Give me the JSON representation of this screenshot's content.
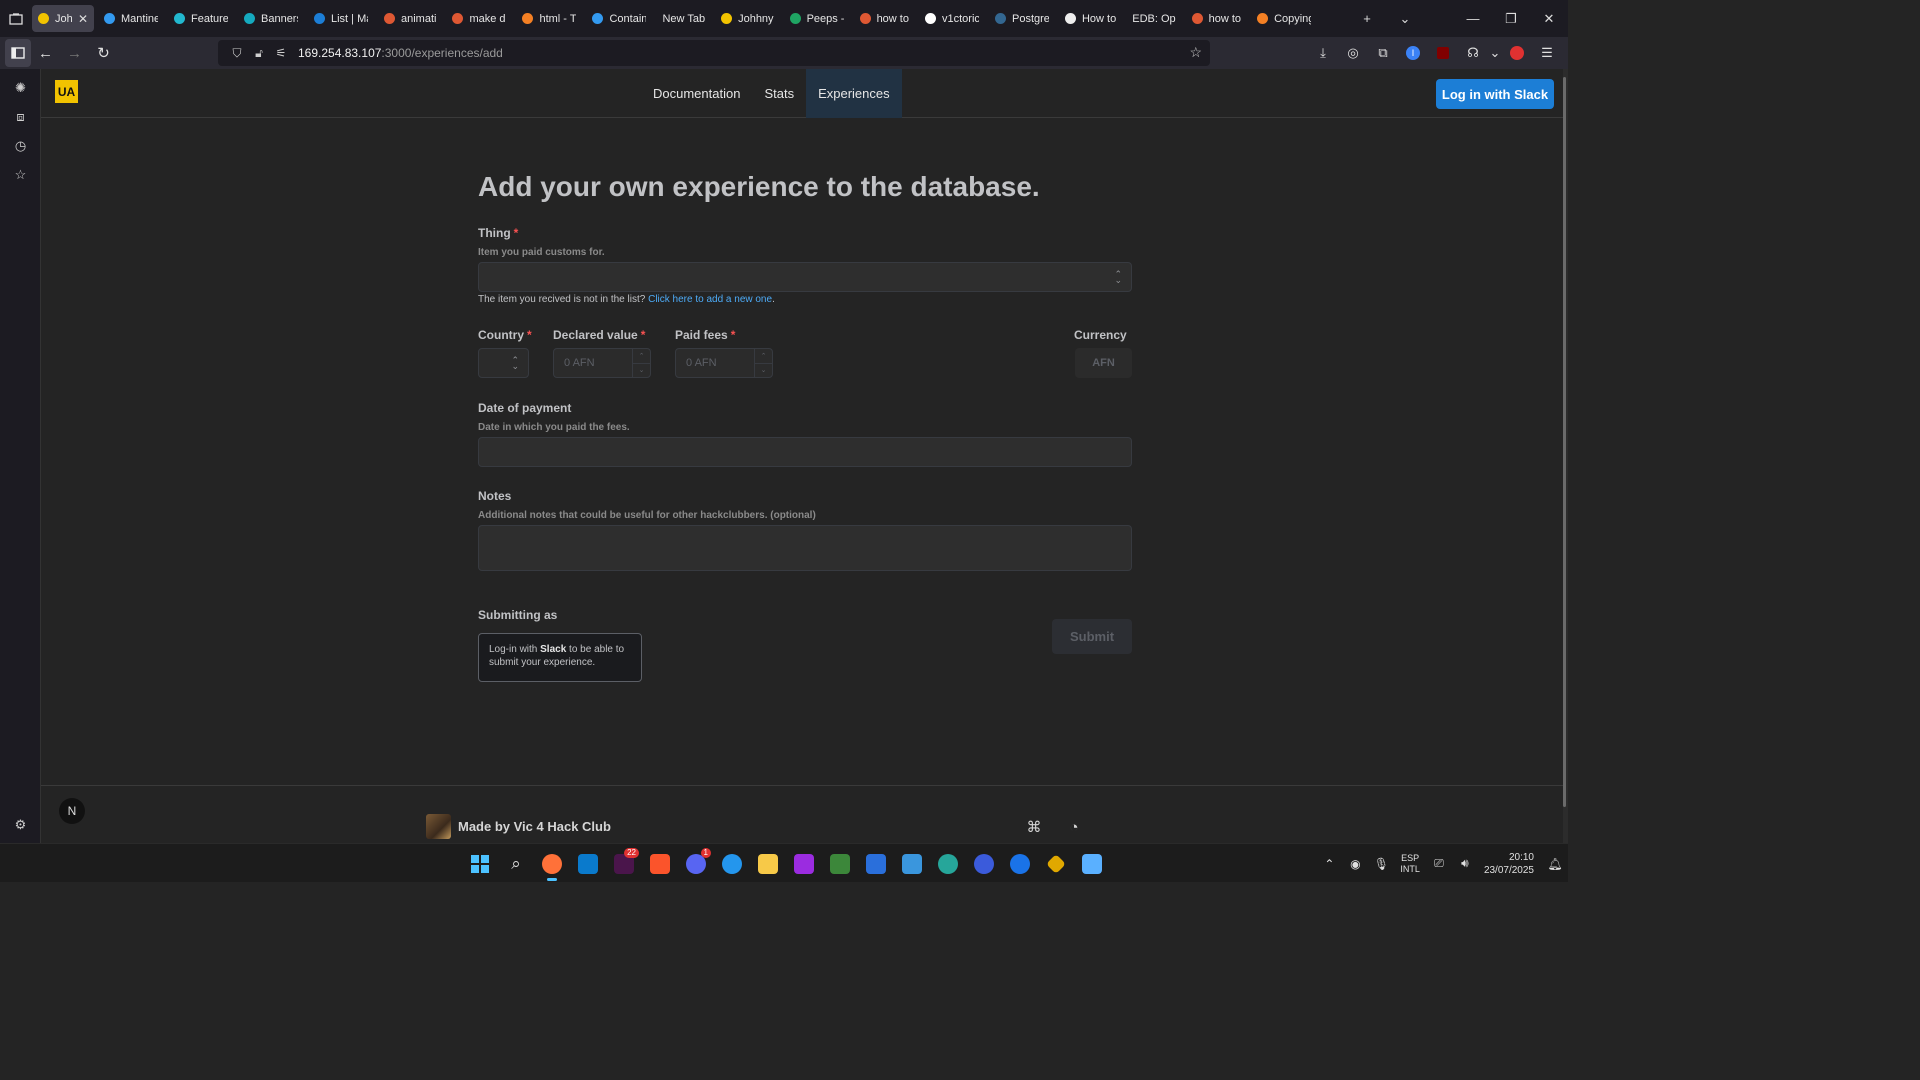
{
  "browser": {
    "tabs": [
      {
        "label": "Johh",
        "icon": "johnny-favicon",
        "color": "#f2c300",
        "active": true
      },
      {
        "label": "Mantine",
        "icon": "mantine-favicon",
        "color": "#339af0"
      },
      {
        "label": "Feature",
        "icon": "mantine-favicon",
        "color": "#22b8cf"
      },
      {
        "label": "Banners",
        "icon": "mantine-favicon",
        "color": "#15aabf"
      },
      {
        "label": "List | Ma",
        "icon": "mantine-favicon",
        "color": "#1c7ed6"
      },
      {
        "label": "animati",
        "icon": "ddg-favicon",
        "color": "#de5833"
      },
      {
        "label": "make di",
        "icon": "ddg-favicon",
        "color": "#de5833"
      },
      {
        "label": "html - T",
        "icon": "stackoverflow-favicon",
        "color": "#f48024"
      },
      {
        "label": "Contain",
        "icon": "mantine-favicon",
        "color": "#339af0"
      },
      {
        "label": "New Tab",
        "icon": "",
        "color": ""
      },
      {
        "label": "Johhny",
        "icon": "johnny-favicon",
        "color": "#f2c300"
      },
      {
        "label": "Peeps -",
        "icon": "sheets-favicon",
        "color": "#1fa463"
      },
      {
        "label": "how to",
        "icon": "ddg-favicon",
        "color": "#de5833"
      },
      {
        "label": "v1ctoric",
        "icon": "github-favicon",
        "color": "#ffffff"
      },
      {
        "label": "Postgre",
        "icon": "postgres-favicon",
        "color": "#336791"
      },
      {
        "label": "How to",
        "icon": "hotjar-favicon",
        "color": "#eeeeee"
      },
      {
        "label": "EDB: Op",
        "icon": "",
        "color": ""
      },
      {
        "label": "how to",
        "icon": "ddg-favicon",
        "color": "#de5833"
      },
      {
        "label": "Copying",
        "icon": "stackoverflow-favicon",
        "color": "#f48024"
      }
    ],
    "url_host": "169.254.83.107",
    "url_rest": ":3000/experiences/add"
  },
  "site": {
    "logo_text": "UA",
    "nav": [
      "Documentation",
      "Stats",
      "Experiences"
    ],
    "login_label": "Log in with Slack"
  },
  "form": {
    "title": "Add your own experience to the database.",
    "thing_label": "Thing",
    "thing_desc": "Item you paid customs for.",
    "help_text": "The item you recived is not in the list?",
    "help_link": "Click here to add a new one",
    "help_dot": ".",
    "country_label": "Country",
    "declared_label": "Declared value",
    "declared_placeholder": "0 AFN",
    "fees_label": "Paid fees",
    "fees_placeholder": "0 AFN",
    "currency_label": "Currency",
    "currency_value": "AFN",
    "date_label": "Date of payment",
    "date_desc": "Date in which you paid the fees.",
    "notes_label": "Notes",
    "notes_desc": "Additional notes that could be useful for other hackclubbers. (optional)",
    "submitting_label": "Submitting as",
    "notice_pre": "Log-in with ",
    "notice_bold": "Slack",
    "notice_post": " to be able to submit your experience.",
    "submit_label": "Submit",
    "required_mark": "*"
  },
  "footer": {
    "made_by": "Made by Vic 4 Hack Club"
  },
  "taskbar": {
    "discord_badge": "1",
    "slack_badge": "22",
    "lang_line1": "ESP",
    "lang_line2": "INTL",
    "time": "20:10",
    "date": "23/07/2025"
  }
}
